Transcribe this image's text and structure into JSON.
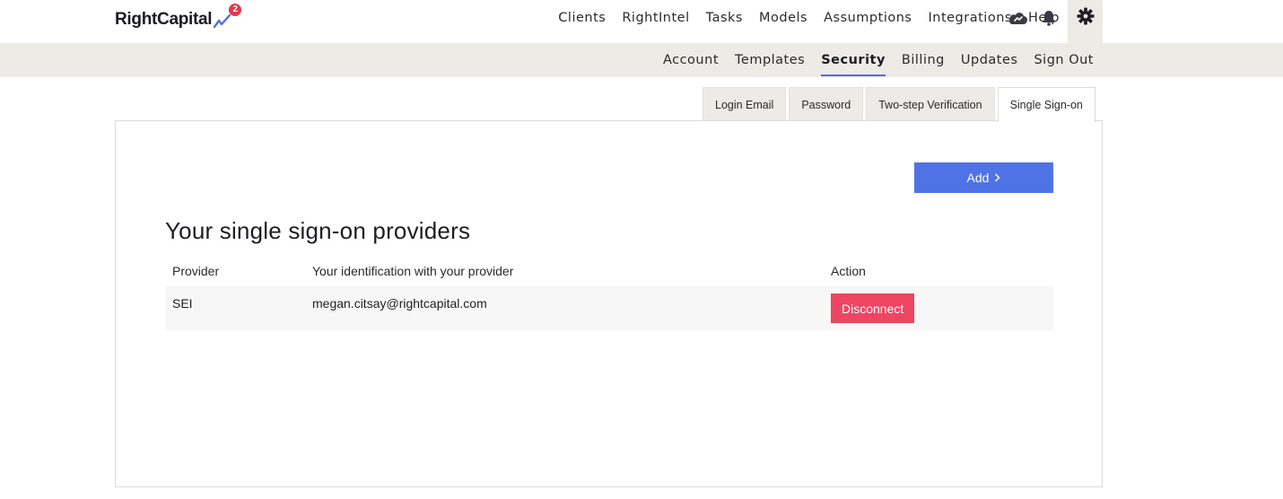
{
  "brand": {
    "name": "RightCapital",
    "badge_count": "2",
    "accent": "#4f73e6"
  },
  "main_nav": {
    "items": [
      "Clients",
      "RightIntel",
      "Tasks",
      "Models",
      "Assumptions",
      "Integrations",
      "Help"
    ],
    "icons": [
      "cloud-sync-icon",
      "bell-icon",
      "gear-icon"
    ]
  },
  "sub_nav": {
    "items": [
      "Account",
      "Templates",
      "Security",
      "Billing",
      "Updates",
      "Sign Out"
    ],
    "active": "Security"
  },
  "tabs": {
    "items": [
      "Login Email",
      "Password",
      "Two-step Verification",
      "Single Sign-on"
    ],
    "active": "Single Sign-on"
  },
  "panel": {
    "add_label": "Add",
    "title": "Your single sign-on providers",
    "columns": [
      "Provider",
      "Your identification with your provider",
      "Action"
    ],
    "rows": [
      {
        "provider": "SEI",
        "identification": "megan.citsay@rightcapital.com",
        "action": "Disconnect"
      }
    ]
  },
  "colors": {
    "primary_button": "#4f73e6",
    "danger_button": "#ee4562",
    "subnav_bg": "#ecebe6",
    "badge": "#e5364b"
  }
}
